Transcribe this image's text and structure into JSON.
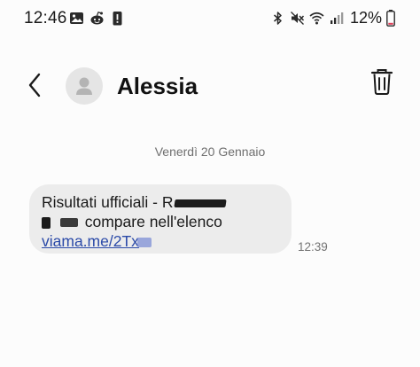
{
  "status_bar": {
    "time": "12:46",
    "battery_percent": "12%",
    "left_icons": [
      "image-icon",
      "reddit-icon",
      "alert-icon"
    ],
    "right_icons": [
      "bluetooth-icon",
      "mute-icon",
      "wifi-icon",
      "signal-icon",
      "battery-icon"
    ]
  },
  "header": {
    "contact_name": "Alessia",
    "back_icon": "chevron-left-icon",
    "delete_icon": "trash-icon"
  },
  "conversation": {
    "date_separator": "Venerdì 20 Gennaio",
    "messages": [
      {
        "line1": "Risultati ufficiali - R",
        "line2": "compare nell'elenco",
        "link": "viama.me/2Tx",
        "time": "12:39"
      }
    ]
  },
  "colors": {
    "background": "#fcfcfc",
    "bubble": "#ececec",
    "link": "#2b4aa8",
    "secondary_text": "#6f6f6f"
  }
}
